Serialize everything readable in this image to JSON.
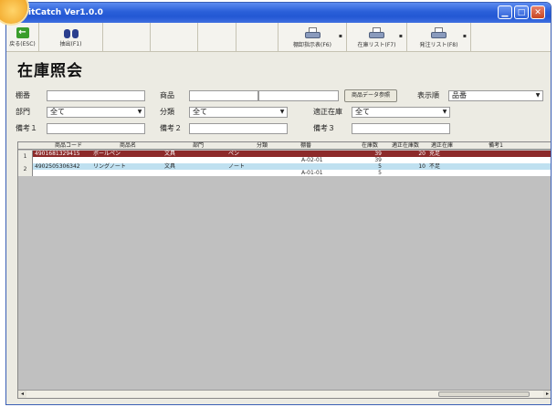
{
  "window": {
    "title": "itCatch Ver1.0.0"
  },
  "toolbar": {
    "back_label": "戻る(ESC)",
    "extract_label": "抽出(F1)",
    "shelf_print_label": "棚卸指示表(F6)",
    "stock_list_label": "在庫リスト(F7)",
    "order_list_label": "発注リスト(F8)"
  },
  "page": {
    "title": "在庫照会"
  },
  "form": {
    "shelf_label": "棚番",
    "product_label": "商品",
    "product_ref_button": "商品データ参照",
    "display_order_label": "表示順",
    "display_order_value": "品番",
    "dept_label": "部門",
    "dept_value": "全て",
    "category_label": "分類",
    "category_value": "全て",
    "proper_stock_label": "適正在庫",
    "proper_stock_value": "全て",
    "note1_label": "備考１",
    "note2_label": "備考２",
    "note3_label": "備考３"
  },
  "grid": {
    "headers": [
      "商品コード",
      "商品名",
      "部門",
      "分類",
      "棚番",
      "在庫数",
      "適正在庫数",
      "適正在庫",
      "備考1"
    ],
    "rows": [
      {
        "num": "1",
        "code": "4901681329415",
        "name": "ボールペン",
        "dept": "文具",
        "category": "ペン",
        "shelf_line1": "",
        "stock_line1": "39",
        "proper_num": "20",
        "proper_flag": "充足",
        "note": "",
        "shelf_line2": "A-02-01",
        "stock_line2": "39"
      },
      {
        "num": "2",
        "code": "4902505306342",
        "name": "リングノート",
        "dept": "文具",
        "category": "ノート",
        "shelf_line1": "",
        "stock_line1": "5",
        "proper_num": "10",
        "proper_flag": "不足",
        "note": "",
        "shelf_line2": "A-01-01",
        "stock_line2": "5"
      }
    ]
  },
  "colors": {
    "title_bar": "#2a5fd8",
    "row_selected": "#8c2a2a",
    "row_alt": "#bfe0f0"
  }
}
